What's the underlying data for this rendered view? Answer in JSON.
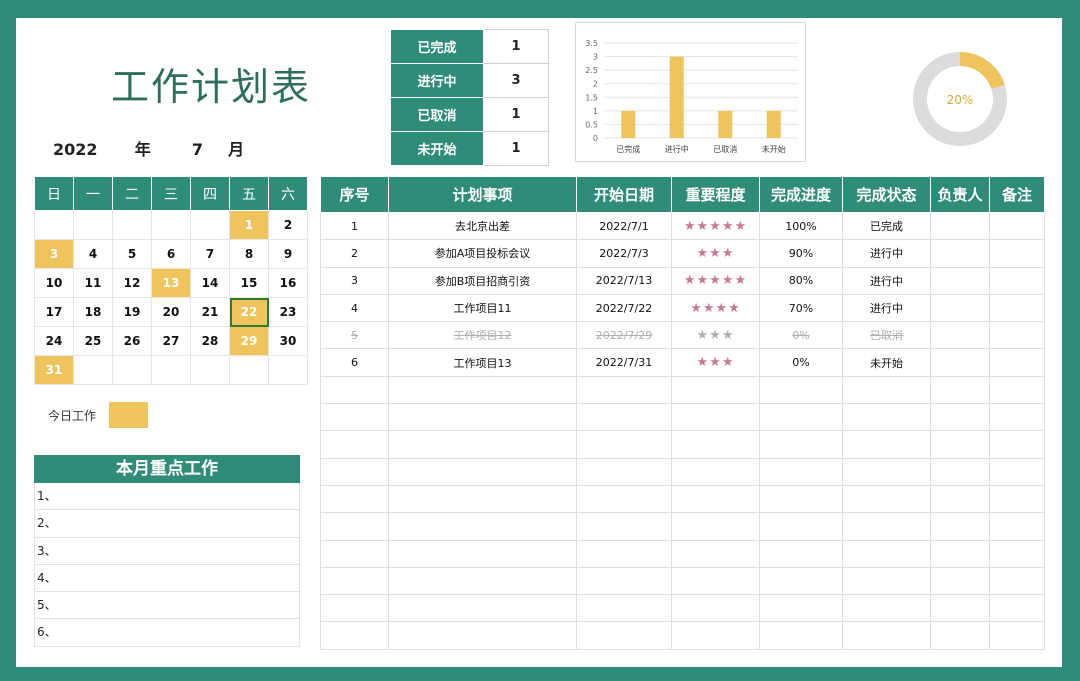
{
  "title": "工作计划表",
  "date": {
    "year": "2022",
    "year_label": "年",
    "month": "7",
    "month_label": "月"
  },
  "status_summary": [
    {
      "label": "已完成",
      "count": "1"
    },
    {
      "label": "进行中",
      "count": "3"
    },
    {
      "label": "已取消",
      "count": "1"
    },
    {
      "label": "未开始",
      "count": "1"
    }
  ],
  "chart_data": [
    {
      "type": "bar",
      "categories": [
        "已完成",
        "进行中",
        "已取消",
        "未开始"
      ],
      "values": [
        1,
        3,
        1,
        1
      ],
      "ylim": [
        0,
        3.5
      ],
      "yticks": [
        "3.5",
        "3",
        "2.5",
        "2",
        "1.5",
        "1",
        "0.5",
        "0"
      ],
      "color": "#f0c45c",
      "grid": true
    },
    {
      "type": "pie",
      "values": [
        20,
        80
      ],
      "label": "20%",
      "colors": [
        "#f0c45c",
        "#dcdcdc"
      ]
    }
  ],
  "calendar": {
    "weekdays": [
      "日",
      "一",
      "二",
      "三",
      "四",
      "五",
      "六"
    ],
    "weeks": [
      [
        "",
        "",
        "",
        "",
        "",
        "1",
        "2"
      ],
      [
        "3",
        "4",
        "5",
        "6",
        "7",
        "8",
        "9"
      ],
      [
        "10",
        "11",
        "12",
        "13",
        "14",
        "15",
        "16"
      ],
      [
        "17",
        "18",
        "19",
        "20",
        "21",
        "22",
        "23"
      ],
      [
        "24",
        "25",
        "26",
        "27",
        "28",
        "29",
        "30"
      ],
      [
        "31",
        "",
        "",
        "",
        "",
        "",
        ""
      ]
    ],
    "highlighted": [
      "1",
      "3",
      "13",
      "22",
      "29",
      "31"
    ],
    "today": "22",
    "highlight_color": "#f0c45c"
  },
  "legend": {
    "label": "今日工作"
  },
  "focus": {
    "title": "本月重点工作",
    "items": [
      "1、",
      "2、",
      "3、",
      "4、",
      "5、",
      "6、"
    ]
  },
  "tasks": {
    "headers": [
      "序号",
      "计划事项",
      "开始日期",
      "重要程度",
      "完成进度",
      "完成状态",
      "负责人",
      "备注"
    ],
    "rows": [
      {
        "no": "1",
        "item": "去北京出差",
        "start": "2022/7/1",
        "stars": "★★★★★",
        "progress": "100%",
        "status": "已完成",
        "owner": "",
        "note": "",
        "cancelled": false
      },
      {
        "no": "2",
        "item": "参加A项目投标会议",
        "start": "2022/7/3",
        "stars": "★★★",
        "progress": "90%",
        "status": "进行中",
        "owner": "",
        "note": "",
        "cancelled": false
      },
      {
        "no": "3",
        "item": "参加B项目招商引资",
        "start": "2022/7/13",
        "stars": "★★★★★",
        "progress": "80%",
        "status": "进行中",
        "owner": "",
        "note": "",
        "cancelled": false
      },
      {
        "no": "4",
        "item": "工作项目11",
        "start": "2022/7/22",
        "stars": "★★★★",
        "progress": "70%",
        "status": "进行中",
        "owner": "",
        "note": "",
        "cancelled": false
      },
      {
        "no": "5",
        "item": "工作项目12",
        "start": "2022/7/29",
        "stars": "★★★",
        "progress": "0%",
        "status": "已取消",
        "owner": "",
        "note": "",
        "cancelled": true
      },
      {
        "no": "6",
        "item": "工作项目13",
        "start": "2022/7/31",
        "stars": "★★★",
        "progress": "0%",
        "status": "未开始",
        "owner": "",
        "note": "",
        "cancelled": false
      }
    ],
    "empty_rows": 10
  }
}
